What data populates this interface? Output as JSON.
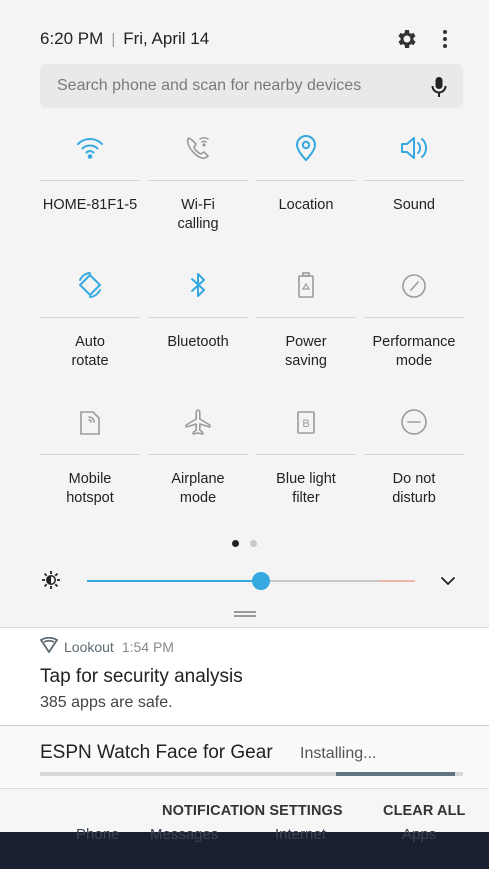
{
  "status_bar": {
    "time": "6:20 PM",
    "separator": "|",
    "date": "Fri, April 14",
    "settings_icon": "gear-icon",
    "more_icon": "more-vert-icon"
  },
  "search": {
    "placeholder": "Search phone and scan for nearby devices",
    "mic_icon": "mic-icon"
  },
  "quick_settings": [
    {
      "label": "HOME-81F1-5",
      "icon": "wifi-icon",
      "active": true
    },
    {
      "label": "Wi-Fi\ncalling",
      "icon": "wifi-calling-icon",
      "active": false
    },
    {
      "label": "Location",
      "icon": "location-pin-icon",
      "active": true
    },
    {
      "label": "Sound",
      "icon": "sound-icon",
      "active": true
    },
    {
      "label": "Auto\nrotate",
      "icon": "auto-rotate-icon",
      "active": true
    },
    {
      "label": "Bluetooth",
      "icon": "bluetooth-icon",
      "active": true
    },
    {
      "label": "Power\nsaving",
      "icon": "power-saving-icon",
      "active": false
    },
    {
      "label": "Performance\nmode",
      "icon": "performance-icon",
      "active": false
    },
    {
      "label": "Mobile\nhotspot",
      "icon": "hotspot-icon",
      "active": false
    },
    {
      "label": "Airplane\nmode",
      "icon": "airplane-icon",
      "active": false
    },
    {
      "label": "Blue light\nfilter",
      "icon": "blue-light-icon",
      "active": false
    },
    {
      "label": "Do not\ndisturb",
      "icon": "do-not-disturb-icon",
      "active": false
    }
  ],
  "page_indicator": {
    "pages": 2,
    "current": 0
  },
  "brightness": {
    "level": 0.53,
    "icon": "brightness-icon",
    "expand_icon": "chevron-down-icon"
  },
  "notifications": [
    {
      "app": "Lookout",
      "time": "1:54 PM",
      "title": "Tap for security analysis",
      "body": "385 apps are safe.",
      "icon": "lookout-shield-icon"
    },
    {
      "title": "ESPN Watch Face for Gear",
      "status": "Installing...",
      "progress_start": 0.7,
      "progress_end": 0.98
    }
  ],
  "footer": {
    "settings_label": "NOTIFICATION SETTINGS",
    "clear_label": "CLEAR ALL"
  },
  "home_dock": [
    "Phone",
    "Messages",
    "Internet",
    "Apps"
  ],
  "colors": {
    "accent": "#35a9e0",
    "inactive_icon": "#9b9b9b",
    "panel_bg": "#f4f4f4"
  }
}
